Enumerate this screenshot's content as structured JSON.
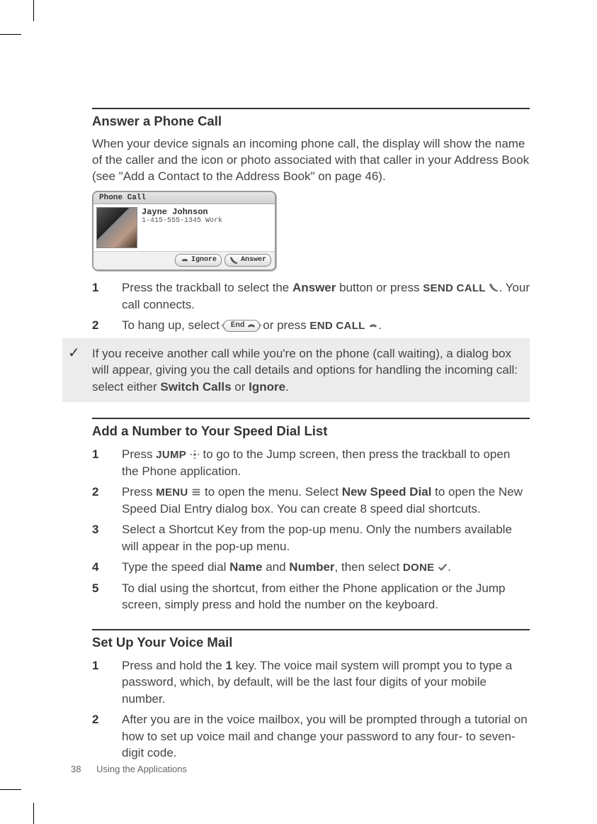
{
  "sections": {
    "answer": {
      "title": "Answer a Phone Call",
      "intro": "When your device signals an incoming phone call, the display will show the name of the caller and the icon or photo associated with that caller in your Address Book (see \"Add a Contact to the Address Book\" on page 46).",
      "mock": {
        "titlebar": "Phone Call",
        "name": "Jayne Johnson",
        "phone": "1-415-555-1345 Work",
        "ignore_btn": "Ignore",
        "answer_btn": "Answer"
      },
      "steps": [
        {
          "num": "1",
          "pre": "Press the trackball to select the ",
          "b1": "Answer",
          "mid": " button or press ",
          "sc": "SEND CALL",
          "icon": "phone-up",
          "post": ". Your call connects."
        },
        {
          "num": "2",
          "pre": "To hang up, select ",
          "end_label": "End",
          "mid": " or press ",
          "sc": "END CALL",
          "icon": "phone-down",
          "post": "."
        }
      ],
      "note": {
        "pre": "If you receive another call while you're on the phone (call waiting), a dialog box will appear, giving you the call details and options for handling the incoming call: select either ",
        "b1": "Switch Calls",
        "mid": " or ",
        "b2": "Ignore",
        "post": "."
      }
    },
    "speed": {
      "title": "Add a Number to Your Speed Dial List",
      "steps": [
        {
          "num": "1",
          "pre": "Press ",
          "sc": "JUMP",
          "icon": "jump",
          "post": " to go to the Jump screen, then press the trackball to open the Phone application."
        },
        {
          "num": "2",
          "pre": "Press ",
          "sc": "MENU",
          "icon": "menu",
          "mid": " to open the menu. Select ",
          "b1": "New Speed Dial",
          "post": " to open the New Speed Dial Entry dialog box. You can create 8 speed dial shortcuts."
        },
        {
          "num": "3",
          "text": "Select a Shortcut Key from the pop-up menu. Only the numbers available will appear in the pop-up menu."
        },
        {
          "num": "4",
          "pre": "Type the speed dial ",
          "b1": "Name",
          "mid": " and ",
          "b2": "Number",
          "post2": ", then select ",
          "sc": "DONE",
          "icon": "done",
          "post": "."
        },
        {
          "num": "5",
          "text": "To dial using the shortcut, from either the Phone application or the Jump screen, simply press and hold the number on the keyboard."
        }
      ]
    },
    "voicemail": {
      "title": "Set Up Your Voice Mail",
      "steps": [
        {
          "num": "1",
          "pre": "Press and hold the ",
          "b1": "1",
          "post": " key. The voice mail system will prompt you to type a password, which, by default, will be the last four digits of your mobile number."
        },
        {
          "num": "2",
          "text": "After you are in the voice mailbox, you will be prompted through a tutorial on how to set up voice mail and change your password to any four- to seven-digit code."
        }
      ]
    }
  },
  "footer": {
    "page": "38",
    "chapter": "Using the Applications"
  }
}
